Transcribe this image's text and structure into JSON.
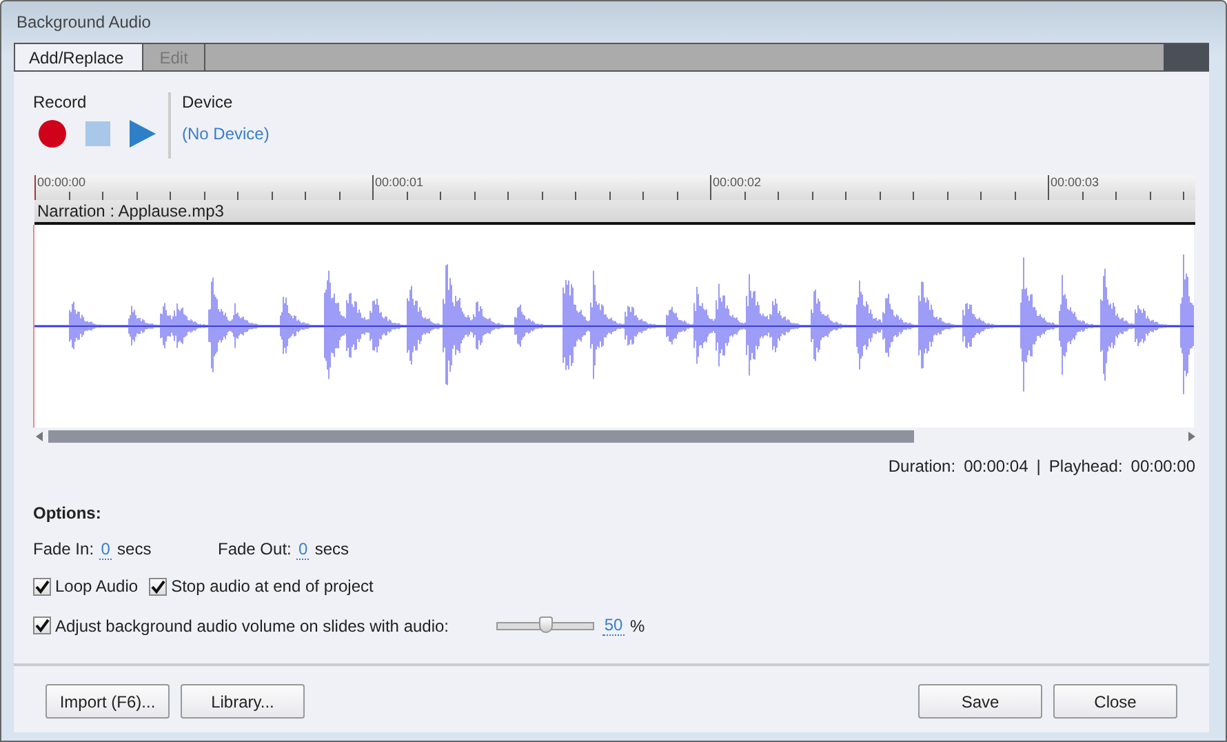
{
  "window": {
    "title": "Background Audio"
  },
  "tabs": [
    {
      "label": "Add/Replace",
      "selected": true
    },
    {
      "label": "Edit",
      "selected": false
    }
  ],
  "record": {
    "label": "Record"
  },
  "device": {
    "label": "Device",
    "value": "(No Device)"
  },
  "timeline": {
    "ruler_labels": [
      "00:00:00",
      "00:00:01",
      "00:00:02",
      "00:00:03"
    ],
    "track_label": "Narration : Applause.mp3"
  },
  "status": {
    "duration_label": "Duration:",
    "duration": "00:00:04",
    "separator": "|",
    "playhead_label": "Playhead:",
    "playhead": "00:00:00"
  },
  "options": {
    "heading": "Options:",
    "fade_in": {
      "label": "Fade In:",
      "value": "0",
      "unit": "secs"
    },
    "fade_out": {
      "label": "Fade Out:",
      "value": "0",
      "unit": "secs"
    },
    "checkboxes": [
      {
        "label": "Loop Audio",
        "checked": true
      },
      {
        "label": "Stop audio at end of project",
        "checked": true
      }
    ],
    "volume": {
      "label": "Adjust background audio volume on slides with audio:",
      "checked": true,
      "level": 0.5,
      "value": "50",
      "unit": "%"
    }
  },
  "left_buttons": [
    "Import (F6)...",
    "Library..."
  ],
  "right_buttons": [
    "Save",
    "Close"
  ]
}
